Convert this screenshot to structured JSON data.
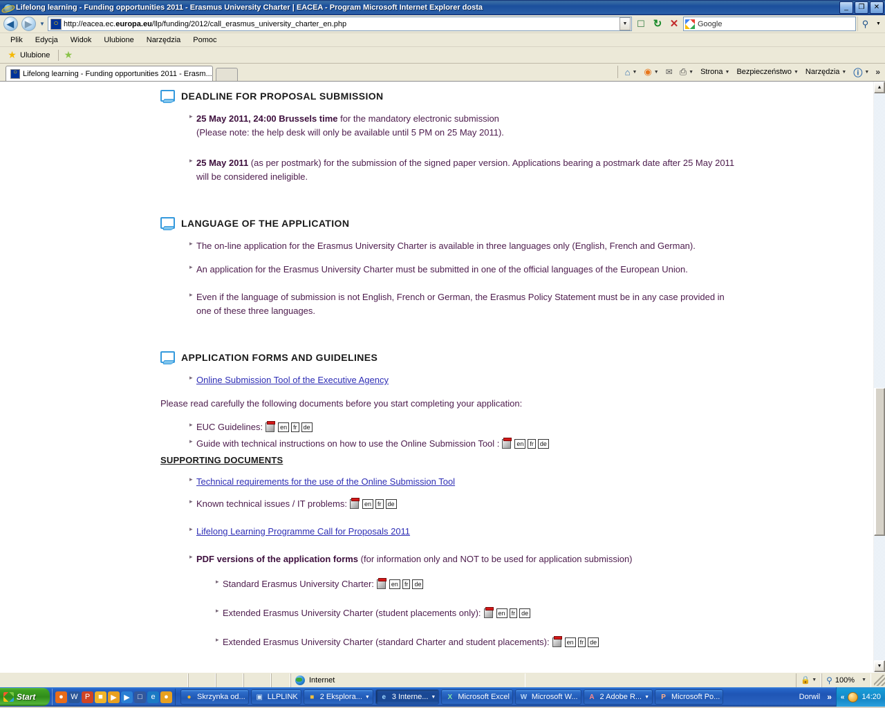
{
  "window": {
    "title": "Lifelong learning - Funding opportunities 2011 - Erasmus University Charter | EACEA - Program Microsoft Internet Explorer dosta",
    "minimize_label": "_",
    "restore_label": "❐",
    "close_label": "✕"
  },
  "address_bar": {
    "back_label": "◀",
    "forward_label": "▶",
    "history_caret": "▼",
    "url_prefix": "http://eacea.ec.",
    "url_bold": "europa.eu",
    "url_suffix": "/llp/funding/2012/call_erasmus_university_charter_en.php",
    "url_full": "http://eacea.ec.europa.eu/llp/funding/2012/call_erasmus_university_charter_en.php",
    "url_dropdown_caret": "▼",
    "feeds_icon": "rss-feed-icon",
    "refresh_label": "↻",
    "stop_label": "✕",
    "search_value": "Google",
    "search_go_label": "⚲",
    "search_caret": "▼"
  },
  "menubar": {
    "items": [
      "Plik",
      "Edycja",
      "Widok",
      "Ulubione",
      "Narzędzia",
      "Pomoc"
    ]
  },
  "favorites_bar": {
    "favorites_label": "Ulubione",
    "add_favorite_label": ""
  },
  "tabs": {
    "items": [
      {
        "label": "Lifelong learning - Funding opportunities 2011 - Erasm..."
      }
    ],
    "new_tab_label": ""
  },
  "command_bar": {
    "home_caret": "▼",
    "feeds_caret": "▼",
    "mail_label": "",
    "print_caret": "▼",
    "page_label": "Strona",
    "safety_label": "Bezpieczeństwo",
    "tools_label": "Narzędzia",
    "help_caret": "▼",
    "overflow_label": "»"
  },
  "page": {
    "sections": [
      {
        "title": "DEADLINE FOR PROPOSAL SUBMISSION",
        "bullets": [
          {
            "bold": "25 May 2011, 24:00 Brussels time",
            "plain": " for the mandatory electronic submission",
            "line2": "(Please note: the help desk will only be available until 5 PM on 25 May 2011)."
          },
          {
            "bold": "25 May 2011",
            "plain": " (as per postmark) for the submission of the signed paper version. Applications bearing a postmark date after 25 May 2011 will be considered ineligible."
          }
        ]
      },
      {
        "title": "LANGUAGE OF THE APPLICATION",
        "bullets": [
          {
            "plain": "The on-line application for the Erasmus University Charter is available in three languages only (English, French and German)."
          },
          {
            "plain": "An application for the Erasmus University Charter must be submitted in one of the official languages of the European Union."
          },
          {
            "plain": "Even if the language of submission is not English, French or German, the Erasmus Policy Statement must be in any case provided in one of these three languages."
          }
        ]
      },
      {
        "title": "APPLICATION FORMS AND GUIDELINES",
        "link_bullet": "Online Submission Tool of the Executive Agency",
        "paragraph": "Please read carefully the following documents before you start completing your application:",
        "doc_rows": [
          {
            "label": "EUC Guidelines:",
            "langs": [
              "en",
              "fr",
              "de"
            ]
          },
          {
            "label": "Guide with technical instructions on how to use the Online Submission Tool :",
            "langs": [
              "en",
              "fr",
              "de"
            ]
          }
        ]
      }
    ],
    "supporting": {
      "heading": "SUPPORTING DOCUMENTS",
      "link1": "Technical requirements for the use of the Online Submission Tool",
      "doc_row": {
        "label": "Known technical issues / IT problems:",
        "langs": [
          "en",
          "fr",
          "de"
        ]
      },
      "link2": "Lifelong Learning Programme Call for Proposals 2011",
      "pdf_versions": {
        "bold": "PDF versions of the application forms",
        "plain": " (for information only and NOT to be used for application submission)"
      },
      "sub_rows": [
        {
          "label": "Standard Erasmus University Charter:",
          "langs": [
            "en",
            "fr",
            "de"
          ]
        },
        {
          "label": "Extended Erasmus University Charter (student placements only):",
          "langs": [
            "en",
            "fr",
            "de"
          ]
        },
        {
          "label": "Extended Erasmus University Charter (standard Charter and student placements):",
          "langs": [
            "en",
            "fr",
            "de"
          ]
        }
      ]
    }
  },
  "scrollbar": {
    "up_label": "▲",
    "down_label": "▼",
    "thumb_top_pct": 52,
    "thumb_height_pct": 26
  },
  "status_bar": {
    "zone_label": "Internet",
    "zone_caret": "▼",
    "zoom_label": "100%",
    "zoom_caret": "▼"
  },
  "taskbar": {
    "start_label": "Start",
    "quick_launch": [
      {
        "name": "firefox-icon",
        "glyph": "●",
        "color": "#e86c1a"
      },
      {
        "name": "word-icon",
        "glyph": "W",
        "color": "#2a5699"
      },
      {
        "name": "powerpoint-icon",
        "glyph": "P",
        "color": "#d04423"
      },
      {
        "name": "folder-icon",
        "glyph": "■",
        "color": "#f0b429"
      },
      {
        "name": "media-player-icon",
        "glyph": "▶",
        "color": "#e8a020"
      },
      {
        "name": "windows-media-icon",
        "glyph": "▶",
        "color": "#2a7fd4"
      },
      {
        "name": "show-desktop-icon",
        "glyph": "□",
        "color": "#33589c"
      },
      {
        "name": "internet-explorer-icon",
        "glyph": "e",
        "color": "#1b7ac4"
      },
      {
        "name": "winamp-icon",
        "glyph": "●",
        "color": "#e8a020"
      }
    ],
    "tasks": [
      {
        "label": "Skrzynka od...",
        "icon": "mail-icon",
        "glyph": "●",
        "color": "#e8a020",
        "active": false,
        "caret": ""
      },
      {
        "label": "LLPLINK",
        "icon": "monitor-icon",
        "glyph": "▣",
        "color": "#9bbbd4",
        "active": false,
        "caret": ""
      },
      {
        "label": "2 Eksplora...",
        "icon": "folder-icon",
        "glyph": "■",
        "color": "#f0b429",
        "active": false,
        "caret": "▼"
      },
      {
        "label": "3 Interne...",
        "icon": "internet-explorer-icon",
        "glyph": "e",
        "color": "#5bb8f5",
        "active": true,
        "caret": "▼"
      },
      {
        "label": "Microsoft Excel",
        "icon": "excel-icon",
        "glyph": "X",
        "color": "#1d7044",
        "active": false,
        "caret": ""
      },
      {
        "label": "Microsoft W...",
        "icon": "word-icon",
        "glyph": "W",
        "color": "#2a5699",
        "active": false,
        "caret": ""
      },
      {
        "label": "2 Adobe R...",
        "icon": "adobe-reader-icon",
        "glyph": "A",
        "color": "#c8202a",
        "active": false,
        "caret": "▼"
      },
      {
        "label": "Microsoft Po...",
        "icon": "powerpoint-icon",
        "glyph": "P",
        "color": "#d04423",
        "active": false,
        "caret": ""
      }
    ],
    "desk_name": "Dorwil",
    "desk_overflow": "»",
    "tray_arrow": "«",
    "clock": "14:20"
  }
}
